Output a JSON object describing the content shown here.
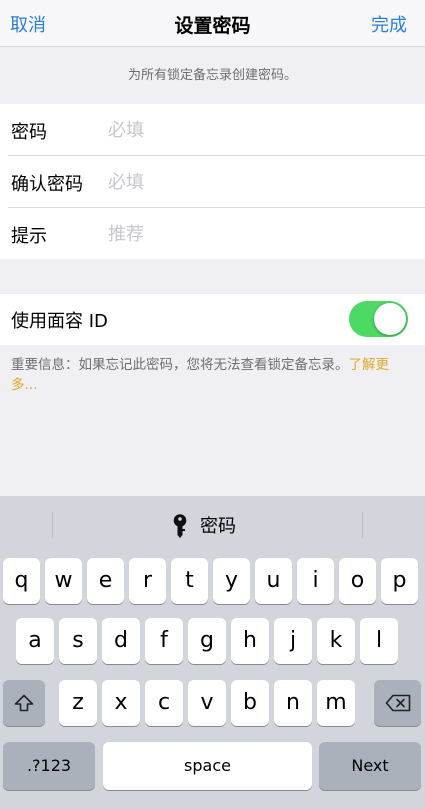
{
  "navbar": {
    "cancel_label": "取消",
    "title": "设置密码",
    "done_label": "完成"
  },
  "hint_top": "为所有锁定备忘录创建密码。",
  "form": {
    "password": {
      "label": "密码",
      "placeholder": "必填",
      "value": ""
    },
    "confirm": {
      "label": "确认密码",
      "placeholder": "必填",
      "value": ""
    },
    "hint": {
      "label": "提示",
      "placeholder": "推荐",
      "value": ""
    }
  },
  "faceid": {
    "label": "使用面容 ID",
    "enabled": true
  },
  "info": {
    "text": "重要信息：如果忘记此密码，您将无法查看锁定备忘录。",
    "link": "了解更多..."
  },
  "keyboard": {
    "suggestion": {
      "icon": "key-icon",
      "label": "密码"
    },
    "row1": [
      "q",
      "w",
      "e",
      "r",
      "t",
      "y",
      "u",
      "i",
      "o",
      "p"
    ],
    "row2": [
      "a",
      "s",
      "d",
      "f",
      "g",
      "h",
      "j",
      "k",
      "l"
    ],
    "row3": [
      "z",
      "x",
      "c",
      "v",
      "b",
      "n",
      "m"
    ],
    "numbers_label": ".?123",
    "space_label": "space",
    "next_label": "Next"
  }
}
